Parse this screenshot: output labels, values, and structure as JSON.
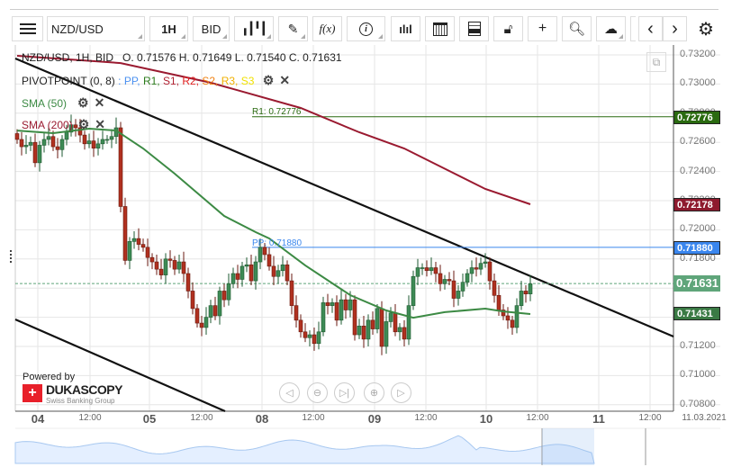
{
  "toolbar": {
    "menu_icon": "hamburger-icon",
    "symbol": "NZD/USD",
    "timeframe": "1H",
    "price_side": "BID",
    "chart_type_icon": "candlestick-icon",
    "draw_icon": "pencil-icon",
    "indicator_label": "f(x)",
    "info_icon": "info-icon",
    "volume_icon": "bar-chart-icon",
    "calendar_icon": "calendar-icon",
    "news_icon": "news-icon",
    "lock_icon": "lock-open-icon",
    "crosshair_icon": "crosshair-icon",
    "zoom_icon": "zoom-chart-icon",
    "cloud_icon": "cloud-upload-icon",
    "prev_icon": "chevron-left-icon",
    "next_icon": "chevron-right-icon",
    "settings_icon": "gear-icon"
  },
  "legend": {
    "ohlc": "NZD/USD, 1H, BID   O. 0.71576 H. 0.71649 L. 0.71540 C. 0.71631",
    "pivot_name": "PIVOTPOINT (0, 8)",
    "pivot_sep": " : ",
    "pivot_levels": [
      {
        "label": "PP",
        "color": "#4a90f0"
      },
      {
        "label": "R1",
        "color": "#2a7a1a"
      },
      {
        "label": "S1",
        "color": "#b02030"
      },
      {
        "label": "R2",
        "color": "#e02020"
      },
      {
        "label": "S2",
        "color": "#f08010"
      },
      {
        "label": "R3",
        "color": "#f0b000"
      },
      {
        "label": "S3",
        "color": "#f0e000"
      }
    ],
    "sma50": "SMA (50)",
    "sma200": "SMA (200)"
  },
  "pivot_lines": {
    "r1_label": "R1: 0.72776",
    "r1_value": 0.72776,
    "pp_label": "PP: 0.71880",
    "pp_value": 0.7188
  },
  "price_labels": [
    {
      "text": "0.72776",
      "value": 0.72776,
      "color": "#2a6a10"
    },
    {
      "text": "0.72178",
      "value": 0.72178,
      "color": "#8e1a2e"
    },
    {
      "text": "0.71880",
      "value": 0.7188,
      "color": "#3a86ee"
    },
    {
      "text": "0.71631",
      "value": 0.71631,
      "color": "#5fa57a"
    },
    {
      "text": "0.71431",
      "value": 0.71431,
      "color": "#3a7a44"
    }
  ],
  "branding": {
    "powered_by": "Powered by",
    "name": "DUKASCOPY",
    "tagline": "Swiss Banking Group"
  },
  "date_stamp": "11.03.2021",
  "nav_buttons": [
    "scroll-left",
    "zoom-out",
    "go-to-latest",
    "zoom-in",
    "scroll-right"
  ],
  "colors": {
    "up": "#3d8a55",
    "down": "#b0301f",
    "sma50": "#3c8a44",
    "sma200": "#9a1a30",
    "trend": "#111111"
  },
  "chart_data": {
    "type": "candlestick",
    "yaxis": {
      "min": 0.708,
      "max": 0.732,
      "ticks": [
        "0.73200",
        "0.73000",
        "0.72800",
        "0.72600",
        "0.72400",
        "0.72200",
        "0.72000",
        "0.71800",
        "0.71600",
        "0.71400",
        "0.71200",
        "0.71000",
        "0.70800"
      ]
    },
    "xaxis": {
      "ticks": [
        {
          "label": "04",
          "day": true
        },
        {
          "label": "12:00"
        },
        {
          "label": "05",
          "day": true
        },
        {
          "label": "12:00"
        },
        {
          "label": "08",
          "day": true
        },
        {
          "label": "12:00"
        },
        {
          "label": "09",
          "day": true
        },
        {
          "label": "12:00"
        },
        {
          "label": "10",
          "day": true
        },
        {
          "label": "12:00"
        },
        {
          "label": "11",
          "day": true
        },
        {
          "label": "12:00"
        }
      ]
    },
    "first_open": 0.7266,
    "closes": [
      0.7262,
      0.7257,
      0.7258,
      0.726,
      0.7246,
      0.7258,
      0.7262,
      0.7264,
      0.7257,
      0.7255,
      0.7262,
      0.7267,
      0.7272,
      0.727,
      0.7265,
      0.7259,
      0.7261,
      0.7256,
      0.7259,
      0.7262,
      0.7262,
      0.7264,
      0.727,
      0.7216,
      0.7179,
      0.7192,
      0.7194,
      0.719,
      0.7188,
      0.7181,
      0.7178,
      0.7173,
      0.7169,
      0.718,
      0.7179,
      0.7173,
      0.7178,
      0.717,
      0.7158,
      0.7146,
      0.7136,
      0.7133,
      0.714,
      0.7148,
      0.7141,
      0.7158,
      0.7152,
      0.7163,
      0.717,
      0.7166,
      0.7175,
      0.7176,
      0.7165,
      0.7178,
      0.7188,
      0.7183,
      0.7175,
      0.7168,
      0.7172,
      0.7176,
      0.7165,
      0.7148,
      0.7138,
      0.713,
      0.7126,
      0.7128,
      0.7122,
      0.713,
      0.715,
      0.7148,
      0.715,
      0.7138,
      0.7152,
      0.7145,
      0.7152,
      0.7128,
      0.7134,
      0.7125,
      0.7138,
      0.7132,
      0.7146,
      0.712,
      0.7137,
      0.7143,
      0.713,
      0.7133,
      0.7125,
      0.7148,
      0.7168,
      0.7174,
      0.7174,
      0.7172,
      0.7174,
      0.717,
      0.7163,
      0.7166,
      0.7165,
      0.7153,
      0.7158,
      0.7164,
      0.717,
      0.7174,
      0.7173,
      0.7177,
      0.7178,
      0.7165,
      0.7155,
      0.7145,
      0.7141,
      0.7138,
      0.7133,
      0.7148,
      0.7158,
      0.7156,
      0.7163
    ],
    "series": [
      {
        "name": "SMA (50)",
        "points": [
          [
            0,
            0.72681
          ],
          [
            8,
            0.72663
          ],
          [
            16,
            0.72694
          ],
          [
            22,
            0.72681
          ],
          [
            28,
            0.72558
          ],
          [
            35,
            0.72385
          ],
          [
            46,
            0.72095
          ],
          [
            53,
            0.71984
          ],
          [
            56,
            0.71941
          ],
          [
            64,
            0.71756
          ],
          [
            74,
            0.71552
          ],
          [
            82,
            0.71447
          ],
          [
            88,
            0.71397
          ],
          [
            95,
            0.71435
          ],
          [
            104,
            0.71459
          ],
          [
            108,
            0.7144
          ],
          [
            114,
            0.71422
          ]
        ]
      },
      {
        "name": "SMA (200)",
        "points": [
          [
            0,
            0.73194
          ],
          [
            23,
            0.73144
          ],
          [
            43,
            0.73009
          ],
          [
            63,
            0.72836
          ],
          [
            76,
            0.72669
          ],
          [
            86,
            0.72558
          ],
          [
            96,
            0.72404
          ],
          [
            104,
            0.7228
          ],
          [
            114,
            0.72175
          ]
        ]
      }
    ],
    "grid": true,
    "current_price": 0.71631
  }
}
